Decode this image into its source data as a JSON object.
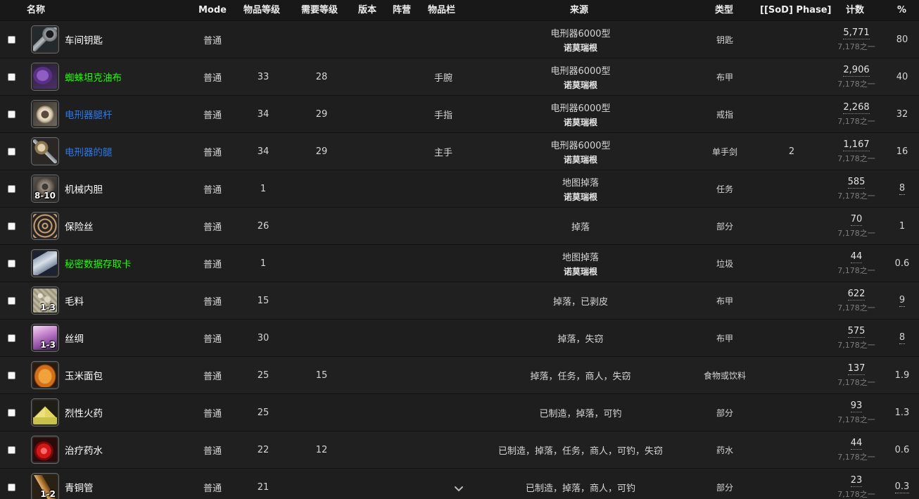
{
  "headers": {
    "name": "名称",
    "mode": "Mode",
    "item_level": "物品等级",
    "req_level": "需要等级",
    "version": "版本",
    "faction": "阵营",
    "slot": "物品栏",
    "source": "来源",
    "type": "类型",
    "phase": "[[SoD] Phase]",
    "count": "计数",
    "percent": "%"
  },
  "colors": {
    "white": "#ffffff",
    "uncommon": "#1eff00",
    "rare": "#2a79ea"
  },
  "rows": [
    {
      "icon": "key-icon",
      "name": "车间钥匙",
      "quality": "white",
      "mode": "普通",
      "item_level": "",
      "req_level": "",
      "slot": "",
      "source": "电刑器6000型",
      "zone": "诺莫瑞根",
      "type": "钥匙",
      "phase": "",
      "count": "5,771",
      "count_of": "7,178之一",
      "percent": "80",
      "underline": false
    },
    {
      "icon": "cloth-wraps-icon",
      "name": "蜘蛛坦克油布",
      "quality": "green",
      "mode": "普通",
      "item_level": "33",
      "req_level": "28",
      "slot": "手腕",
      "source": "电刑器6000型",
      "zone": "诺莫瑞根",
      "type": "布甲",
      "phase": "",
      "count": "2,906",
      "count_of": "7,178之一",
      "percent": "40",
      "underline": false
    },
    {
      "icon": "ring-icon",
      "name": "电刑器腿杆",
      "quality": "blue",
      "mode": "普通",
      "item_level": "34",
      "req_level": "29",
      "slot": "手指",
      "source": "电刑器6000型",
      "zone": "诺莫瑞根",
      "type": "戒指",
      "phase": "",
      "count": "2,268",
      "count_of": "7,178之一",
      "percent": "32",
      "underline": false
    },
    {
      "icon": "sword-icon",
      "name": "电刑器的腿",
      "quality": "blue",
      "mode": "普通",
      "item_level": "34",
      "req_level": "29",
      "slot": "主手",
      "source": "电刑器6000型",
      "zone": "诺莫瑞根",
      "type": "单手剑",
      "phase": "2",
      "count": "1,167",
      "count_of": "7,178之一",
      "percent": "16",
      "underline": false
    },
    {
      "icon": "gear-icon",
      "stack": "8-10",
      "name": "机械内胆",
      "quality": "white",
      "mode": "普通",
      "item_level": "1",
      "req_level": "",
      "slot": "",
      "source": "地图掉落",
      "zone": "诺莫瑞根",
      "type": "任务",
      "phase": "",
      "count": "585",
      "count_of": "7,178之一",
      "percent": "8",
      "underline": true
    },
    {
      "icon": "fuse-wire-icon",
      "name": "保险丝",
      "quality": "white",
      "mode": "普通",
      "item_level": "26",
      "req_level": "",
      "slot": "",
      "source": "掉落",
      "zone": "",
      "type": "部分",
      "phase": "",
      "count": "70",
      "count_of": "7,178之一",
      "percent": "1",
      "underline": false
    },
    {
      "icon": "data-card-icon",
      "name": "秘密数据存取卡",
      "quality": "green",
      "mode": "普通",
      "item_level": "1",
      "req_level": "",
      "slot": "",
      "source": "地图掉落",
      "zone": "诺莫瑞根",
      "type": "垃圾",
      "phase": "",
      "count": "44",
      "count_of": "7,178之一",
      "percent": "0.6",
      "underline": false
    },
    {
      "icon": "wool-icon",
      "stack": "1-3",
      "name": "毛料",
      "quality": "white",
      "mode": "普通",
      "item_level": "15",
      "req_level": "",
      "slot": "",
      "source": "掉落，已剥皮",
      "zone": "",
      "type": "布甲",
      "phase": "",
      "count": "622",
      "count_of": "7,178之一",
      "percent": "9",
      "underline": true
    },
    {
      "icon": "silk-icon",
      "stack": "1-3",
      "name": "丝绸",
      "quality": "white",
      "mode": "普通",
      "item_level": "30",
      "req_level": "",
      "slot": "",
      "source": "掉落，失窃",
      "zone": "",
      "type": "布甲",
      "phase": "",
      "count": "575",
      "count_of": "7,178之一",
      "percent": "8",
      "underline": true
    },
    {
      "icon": "bread-icon",
      "name": "玉米面包",
      "quality": "white",
      "mode": "普通",
      "item_level": "25",
      "req_level": "15",
      "slot": "",
      "source": "掉落，任务，商人，失窃",
      "zone": "",
      "type": "食物或饮料",
      "phase": "",
      "count": "137",
      "count_of": "7,178之一",
      "percent": "1.9",
      "underline": false
    },
    {
      "icon": "powder-icon",
      "name": "烈性火药",
      "quality": "white",
      "mode": "普通",
      "item_level": "25",
      "req_level": "",
      "slot": "",
      "source": "已制造，掉落，可钓",
      "zone": "",
      "type": "部分",
      "phase": "",
      "count": "93",
      "count_of": "7,178之一",
      "percent": "1.3",
      "underline": false
    },
    {
      "icon": "potion-icon",
      "name": "治疗药水",
      "quality": "white",
      "mode": "普通",
      "item_level": "22",
      "req_level": "12",
      "slot": "",
      "source": "已制造，掉落，任务，商人，可钓，失窃",
      "zone": "",
      "type": "药水",
      "phase": "",
      "count": "44",
      "count_of": "7,178之一",
      "percent": "0.6",
      "underline": false
    },
    {
      "icon": "bronze-tube-icon",
      "stack": "1-2",
      "name": "青铜管",
      "quality": "white",
      "mode": "普通",
      "item_level": "21",
      "req_level": "",
      "slot": "",
      "source": "已制造，掉落，商人，可钓",
      "zone": "",
      "type": "部分",
      "phase": "",
      "count": "23",
      "count_of": "7,178之一",
      "percent": "0.3",
      "underline": true
    }
  ]
}
